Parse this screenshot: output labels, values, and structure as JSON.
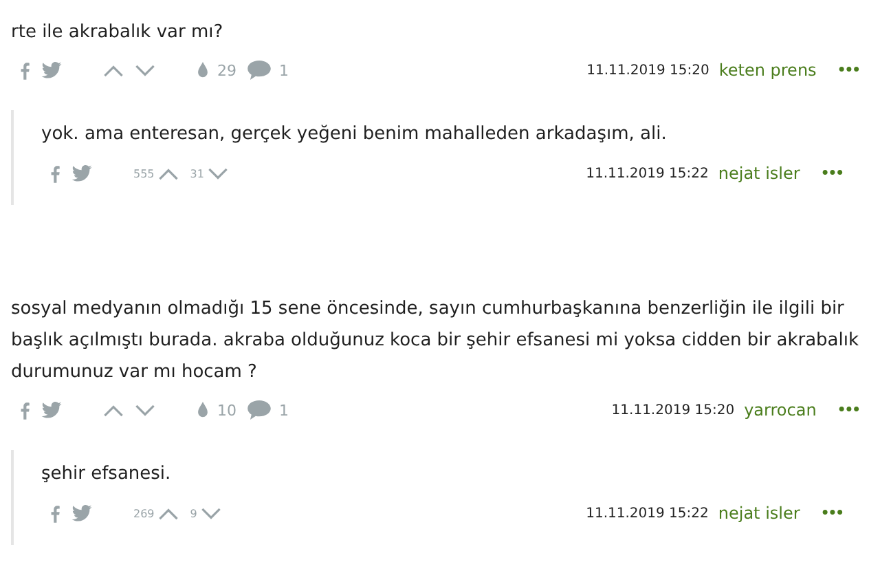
{
  "items": [
    {
      "kind": "entry",
      "text": "rte ile akrabalık var mı?",
      "favorites": "29",
      "comments": "1",
      "date": "11.11.2019 15:20",
      "author": "keten prens",
      "more": "•••"
    },
    {
      "kind": "reply",
      "text": "yok. ama enteresan, gerçek yeğeni benim mahalleden arkadaşım, ali.",
      "upvotes": "555",
      "downvotes": "31",
      "date": "11.11.2019 15:22",
      "author": "nejat isler",
      "more": "•••"
    },
    {
      "kind": "entry",
      "text": "sosyal medyanın olmadığı 15 sene öncesinde, sayın cumhurbaşkanına benzerliğin ile ilgili bir başlık açılmıştı burada. akraba olduğunuz koca bir şehir efsanesi mi yoksa cidden bir akrabalık durumunuz var mı hocam ?",
      "favorites": "10",
      "comments": "1",
      "date": "11.11.2019 15:20",
      "author": "yarrocan",
      "more": "•••"
    },
    {
      "kind": "reply",
      "text": "şehir efsanesi.",
      "upvotes": "269",
      "downvotes": "9",
      "date": "11.11.2019 15:22",
      "author": "nejat isler",
      "more": "•••"
    }
  ]
}
